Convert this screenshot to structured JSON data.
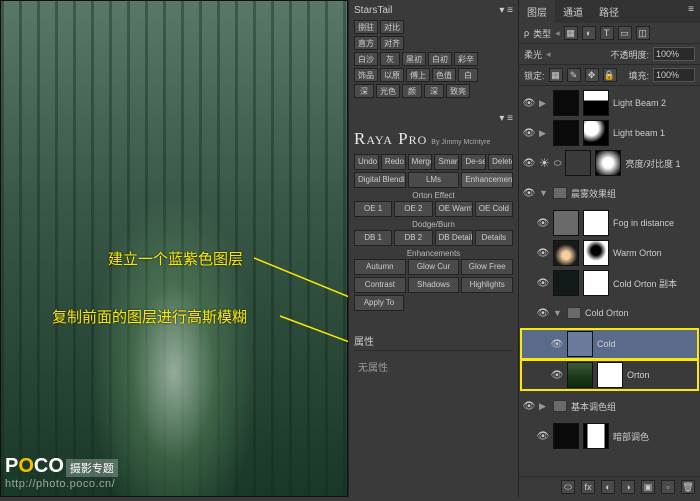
{
  "annotations": {
    "line1": "建立一个蓝紫色图层",
    "line2": "复制前面的图层进行高斯模糊"
  },
  "watermark": {
    "brand_prefix": "P",
    "brand_o": "O",
    "brand_suffix": "CO",
    "sub": "摄影专题",
    "url": "http://photo.poco.cn/"
  },
  "starstail": {
    "title": "StarsTail",
    "rows": [
      [
        "捌驻",
        "对比"
      ],
      [
        "直方",
        "对齐"
      ],
      [
        "白沙",
        "灰",
        "黑初",
        "白初",
        "彩辛"
      ],
      [
        "饰品",
        "以原",
        "傅上",
        "色值",
        "白"
      ],
      [
        "深",
        "光色",
        "颜",
        "深",
        "致亮"
      ]
    ]
  },
  "raya": {
    "title": "Raya Pro",
    "byline": "By Jimmy McIntyre",
    "row1": [
      "Undo",
      "Redo",
      "Merge",
      "Smart",
      "De-sel",
      "Delete"
    ],
    "row2": [
      "Digital Blending",
      "LMs",
      "Enhancements"
    ],
    "sec_orton": "Orton Effect",
    "orton": [
      "OE 1",
      "OE 2",
      "OE Warm",
      "OE Cold"
    ],
    "sec_db": "Dodge/Burn",
    "db": [
      "DB 1",
      "DB 2",
      "DB Details",
      "Details"
    ],
    "sec_enh": "Enhancements",
    "enh1": [
      "Autumn",
      "Glow Cur",
      "Glow Free"
    ],
    "enh2": [
      "Contrast",
      "Shadows",
      "Highlights"
    ],
    "apply": "Apply To"
  },
  "properties": {
    "title": "属性",
    "body": "无属性"
  },
  "layersPanel": {
    "tabs": [
      "图层",
      "通道",
      "路径"
    ],
    "kind": "类型",
    "opacityLabel": "不透明度:",
    "opacity": "100%",
    "blendLabel": "柔光",
    "fillLabel": "填充:",
    "fill": "100%",
    "lockLabel": "锁定:"
  },
  "layers": [
    {
      "type": "layer",
      "name": "Light Beam 2",
      "eye": true,
      "chev": "▶",
      "thumb": "#0a0a0a",
      "mask": "beam"
    },
    {
      "type": "layer",
      "name": "Light beam 1",
      "eye": true,
      "chev": "▶",
      "thumb": "#0a0a0a",
      "mask": "beam2"
    },
    {
      "type": "layer",
      "name": "亮度/对比度 1",
      "eye": true,
      "fx": true,
      "thumb": "adj",
      "mask": "grad"
    },
    {
      "type": "group",
      "name": "晨雾效果组",
      "eye": true,
      "open": true
    },
    {
      "type": "layer",
      "name": "Fog in distance",
      "eye": true,
      "indent": 1,
      "thumb": "#6a6a6a",
      "mask": "#fff"
    },
    {
      "type": "layer",
      "name": "Warm Orton",
      "eye": true,
      "indent": 1,
      "thumb": "warm",
      "mask": "inv"
    },
    {
      "type": "layer",
      "name": "Cold Orton 副本",
      "eye": true,
      "indent": 1,
      "thumb": "#121a1a",
      "mask": "#fff"
    },
    {
      "type": "group",
      "name": "Cold Orton",
      "eye": true,
      "open": true,
      "indent": 1
    },
    {
      "type": "layer",
      "name": "Cold",
      "eye": true,
      "indent": 2,
      "thumb": "#6a7a9a",
      "selected": true,
      "hl": true
    },
    {
      "type": "layer",
      "name": "Orton",
      "eye": true,
      "indent": 2,
      "thumb": "forest",
      "mask": "#fff",
      "hl": true
    },
    {
      "type": "group",
      "name": "基本调色组",
      "eye": true,
      "indent": 0
    },
    {
      "type": "layer",
      "name": "暗部调色",
      "eye": true,
      "indent": 1,
      "thumb": "#0a0a0a",
      "mask": "vmask"
    }
  ]
}
